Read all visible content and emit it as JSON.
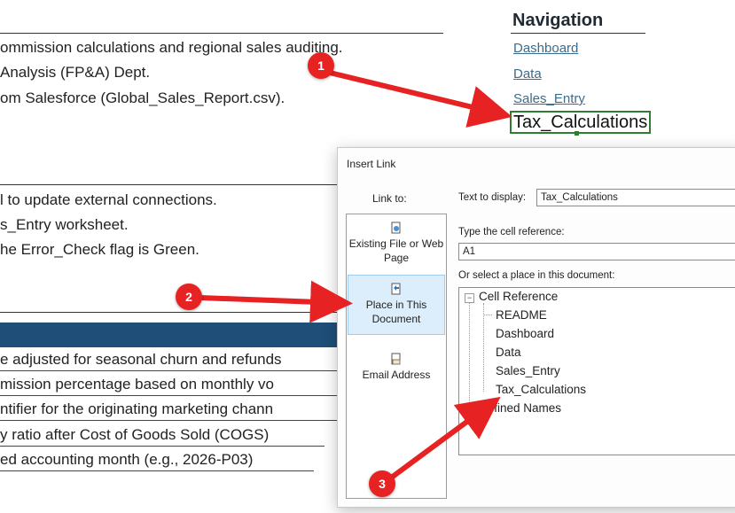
{
  "sheet": {
    "lines_top": [
      "ommission calculations and regional sales auditing.",
      "Analysis (FP&A) Dept.",
      "om Salesforce (Global_Sales_Report.csv)."
    ],
    "lines_mid": [
      "l to update external connections.",
      "s_Entry worksheet.",
      "he Error_Check flag is Green."
    ],
    "rows": [
      "e adjusted for seasonal churn and refunds",
      "mission percentage based on monthly vo",
      "ntifier for the originating marketing chann",
      "y ratio after Cost of Goods Sold (COGS)",
      "ed accounting month (e.g., 2026-P03)"
    ]
  },
  "navigation": {
    "title": "Navigation",
    "links": [
      "Dashboard",
      "Data",
      "Sales_Entry"
    ],
    "active_cell": "Tax_Calculations"
  },
  "dialog": {
    "title": "Insert Link",
    "link_to_label": "Link to:",
    "options": [
      {
        "label": "Existing File or Web Page",
        "icon": "document-globe-icon"
      },
      {
        "label": "Place in This Document",
        "icon": "document-place-icon",
        "selected": true
      },
      {
        "label": "Email Address",
        "icon": "email-icon"
      }
    ],
    "text_to_display_label": "Text to display:",
    "text_to_display_value": "Tax_Calculations",
    "cell_ref_label": "Type the cell reference:",
    "cell_ref_value": "A1",
    "place_label": "Or select a place in this document:",
    "tree": {
      "cell_reference": "Cell Reference",
      "sheets": [
        "README",
        "Dashboard",
        "Data",
        "Sales_Entry",
        "Tax_Calculations"
      ],
      "defined_names": "Defined Names"
    }
  },
  "annotations": [
    "1",
    "2",
    "3"
  ],
  "colors": {
    "accent": "#e62222",
    "banner": "#1f4e79",
    "link": "#3d6b8c",
    "cell_border": "#2e7d32"
  }
}
